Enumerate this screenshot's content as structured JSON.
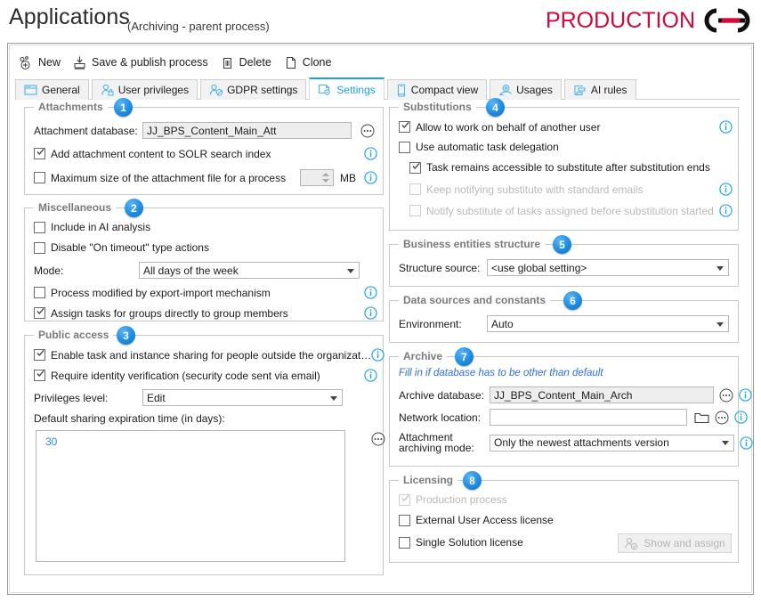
{
  "header": {
    "title": "Applications",
    "subtitle": "(Archiving - parent process)",
    "brand_text": "PRODUCTION",
    "brand_color": "#d6083b"
  },
  "toolbar": {
    "items": [
      {
        "label": "New",
        "icon": "new-process-icon"
      },
      {
        "label": "Save & publish process",
        "icon": "save-publish-icon"
      },
      {
        "label": "Delete",
        "icon": "trash-icon"
      },
      {
        "label": "Clone",
        "icon": "clone-icon"
      }
    ]
  },
  "tabs": [
    {
      "label": "General",
      "icon": "window-icon",
      "active": false
    },
    {
      "label": "User privileges",
      "icon": "user-lock-icon",
      "active": false
    },
    {
      "label": "GDPR settings",
      "icon": "user-shield-icon",
      "active": false
    },
    {
      "label": "Settings",
      "icon": "settings-gear-icon",
      "active": true
    },
    {
      "label": "Compact view",
      "icon": "mobile-icon",
      "active": false
    },
    {
      "label": "Usages",
      "icon": "usages-icon",
      "active": false
    },
    {
      "label": "AI rules",
      "icon": "ai-rules-icon",
      "active": false
    }
  ],
  "groups": {
    "attachments": {
      "title": "Attachments",
      "badge": "1",
      "database_label": "Attachment database:",
      "database_value": "JJ_BPS_Content_Main_Att",
      "solr_label": "Add attachment content to SOLR search index",
      "solr_checked": true,
      "maxsize_label": "Maximum size of the attachment file for a process",
      "maxsize_checked": false,
      "maxsize_value": "",
      "maxsize_unit": "MB"
    },
    "miscellaneous": {
      "title": "Miscellaneous",
      "badge": "2",
      "ai_analysis_label": "Include in AI analysis",
      "ai_analysis_checked": false,
      "disable_timeout_label": "Disable \"On timeout\" type actions",
      "disable_timeout_checked": false,
      "mode_label": "Mode:",
      "mode_value": "All days of the week",
      "export_import_label": "Process modified by export-import mechanism",
      "export_import_checked": false,
      "assign_groups_label": "Assign tasks for groups directly to group members",
      "assign_groups_checked": true
    },
    "public_access": {
      "title": "Public access",
      "badge": "3",
      "enable_sharing_label": "Enable task and instance sharing for people outside the organizat…",
      "enable_sharing_checked": true,
      "identity_label": "Require identity verification (security code sent via email)",
      "identity_checked": true,
      "privileges_label": "Privileges level:",
      "privileges_value": "Edit",
      "expiration_label": "Default sharing expiration time (in days):",
      "expiration_value": "30"
    },
    "substitutions": {
      "title": "Substitutions",
      "badge": "4",
      "behalf_label": "Allow to work on behalf of another user",
      "behalf_checked": true,
      "auto_delegation_label": "Use automatic task delegation",
      "auto_delegation_checked": false,
      "remains_label": "Task remains accessible to substitute after substitution ends",
      "remains_checked": true,
      "keep_notify_label": "Keep notifying substitute with standard emails",
      "keep_notify_checked": false,
      "keep_notify_disabled": true,
      "notify_before_label": "Notify substitute of tasks assigned before substitution started",
      "notify_before_checked": false,
      "notify_before_disabled": true
    },
    "business_entities": {
      "title": "Business entities structure",
      "badge": "5",
      "source_label": "Structure source:",
      "source_value": "<use global setting>"
    },
    "data_sources": {
      "title": "Data sources and constants",
      "badge": "6",
      "environment_label": "Environment:",
      "environment_value": "Auto"
    },
    "archive": {
      "title": "Archive",
      "badge": "7",
      "hint": "Fill in if database has to be other than default",
      "database_label": "Archive database:",
      "database_value": "JJ_BPS_Content_Main_Arch",
      "network_label": "Network location:",
      "network_value": "",
      "mode_label_line1": "Attachment",
      "mode_label_line2": "archiving mode:",
      "mode_value": "Only the newest attachments version"
    },
    "licensing": {
      "title": "Licensing",
      "badge": "8",
      "production_label": "Production process",
      "production_checked": true,
      "production_disabled": true,
      "external_label": "External User Access license",
      "external_checked": false,
      "single_label": "Single Solution license",
      "single_checked": false,
      "show_assign_label": "Show and assign",
      "show_assign_disabled": true
    }
  }
}
